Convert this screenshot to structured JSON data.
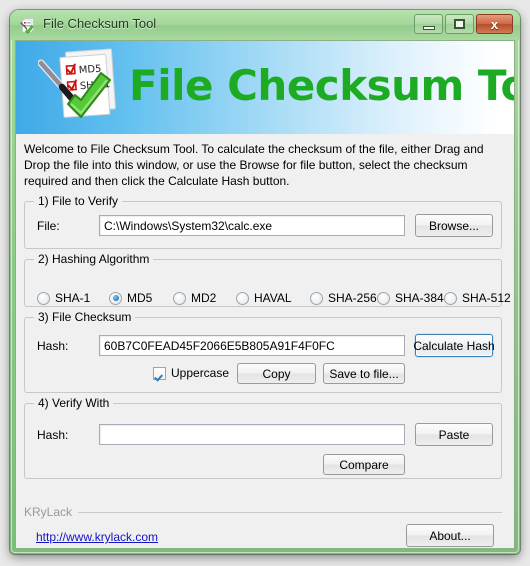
{
  "window": {
    "title": "File Checksum Tool",
    "icon": "checklist-pen-check-icon",
    "controls": {
      "minimize": "—",
      "maximize": "□",
      "close": "x"
    },
    "frame_color": "#8fc98a"
  },
  "banner": {
    "title": "File Checksum Tool",
    "title_color": "#1eab24",
    "gradient_from": "#3fa9e8",
    "gradient_to": "#ffffff",
    "logo": {
      "name": "checklist-pen-check-icon",
      "items": [
        "MD5",
        "SHA-1"
      ],
      "check_color": "#cc1111",
      "tick_color": "#4fbe2f"
    }
  },
  "welcome": {
    "text": "Welcome to File Checksum Tool. To calculate the checksum of the file, either Drag and Drop the file into this window, or use the Browse for file button, select the checksum required and then click the Calculate Hash button."
  },
  "file_group": {
    "legend": "1) File to Verify",
    "file_label": "File:",
    "file_value": "C:\\Windows\\System32\\calc.exe",
    "browse_label": "Browse..."
  },
  "algorithm_group": {
    "legend": "2) Hashing Algorithm",
    "selected": "MD5",
    "options": [
      {
        "label": "SHA-1",
        "selected": false
      },
      {
        "label": "MD5",
        "selected": true
      },
      {
        "label": "MD2",
        "selected": false
      },
      {
        "label": "HAVAL",
        "selected": false
      },
      {
        "label": "SHA-256",
        "selected": false
      },
      {
        "label": "SHA-384",
        "selected": false
      },
      {
        "label": "SHA-512",
        "selected": false
      }
    ]
  },
  "checksum_group": {
    "legend": "3) File Checksum",
    "hash_label": "Hash:",
    "hash_value": "60B7C0FEAD45F2066E5B805A91F4F0FC",
    "calculate_label": "Calculate Hash",
    "uppercase_label": "Uppercase",
    "uppercase_checked": true,
    "copy_label": "Copy",
    "save_label": "Save to file..."
  },
  "verify_group": {
    "legend": "4) Verify With",
    "hash_label": "Hash:",
    "hash_value": "",
    "paste_label": "Paste",
    "compare_label": "Compare"
  },
  "footer": {
    "brand": "KRyLack",
    "link": "http://www.krylack.com",
    "link_color": "#1414c8",
    "about_label": "About..."
  }
}
